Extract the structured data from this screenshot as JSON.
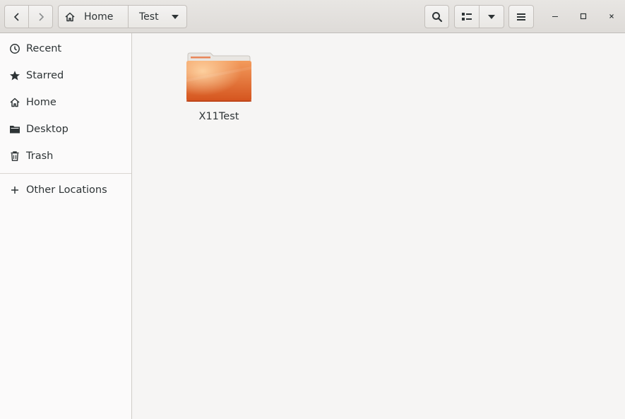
{
  "header": {
    "nav": {
      "back_icon": "chevron-left-icon",
      "forward_icon": "chevron-right-icon"
    },
    "path": [
      {
        "label": "Home",
        "icon": "home-icon"
      },
      {
        "label": "Test",
        "icon": "dropdown-arrow-icon"
      }
    ],
    "toolbar": {
      "search_icon": "search-icon",
      "view_icon": "list-view-icon",
      "view_menu_icon": "chevron-down-icon",
      "menu_icon": "hamburger-menu-icon"
    },
    "window_controls": [
      "minimize-icon",
      "maximize-icon",
      "close-icon"
    ]
  },
  "sidebar": {
    "items": [
      {
        "label": "Recent",
        "icon": "clock-icon"
      },
      {
        "label": "Starred",
        "icon": "star-icon"
      },
      {
        "label": "Home",
        "icon": "home-icon"
      },
      {
        "label": "Desktop",
        "icon": "folder-icon"
      },
      {
        "label": "Trash",
        "icon": "trash-icon"
      }
    ],
    "other": {
      "label": "Other Locations",
      "icon": "plus-icon"
    }
  },
  "main": {
    "items": [
      {
        "name": "X11Test",
        "icon": "folder-icon"
      }
    ]
  },
  "colors": {
    "headerbar": "#dedbd8",
    "sidebar": "#fbfafa",
    "content": "#f6f5f4",
    "folder_orange": "#e26a2c"
  }
}
